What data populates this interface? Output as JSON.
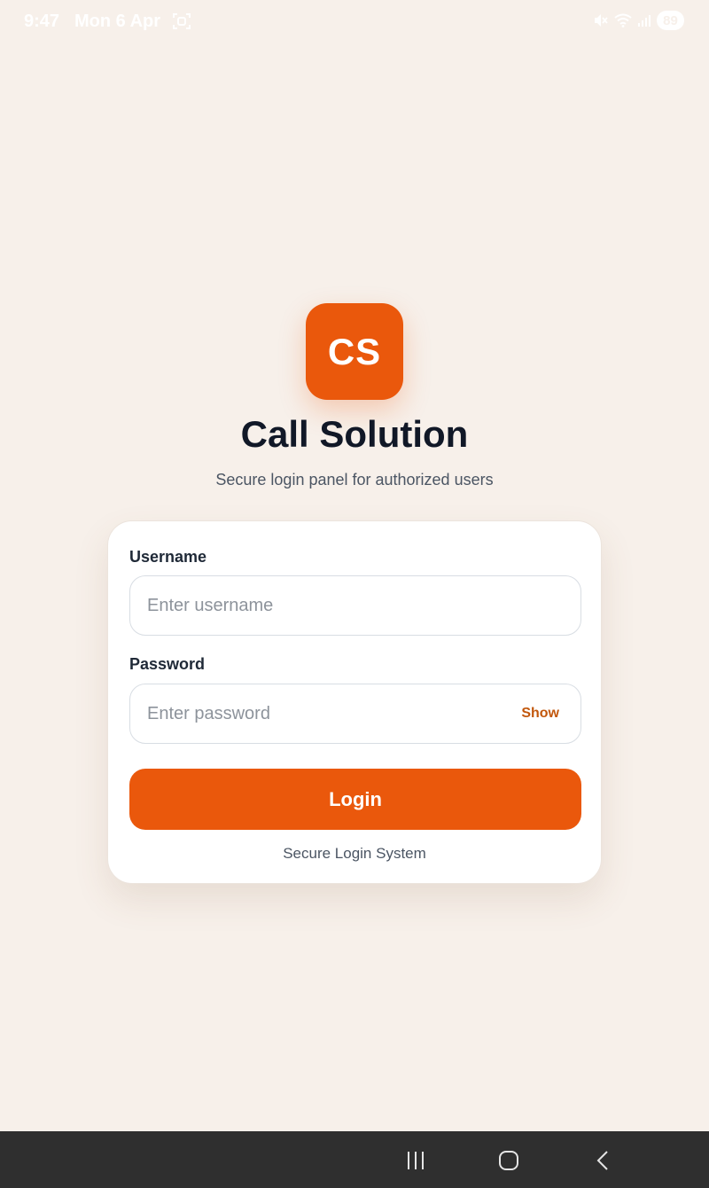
{
  "status_bar": {
    "time": "9:47",
    "date": "Mon 6 Apr",
    "battery": "89",
    "icons": [
      "screenshot-icon",
      "mute-icon",
      "wifi-icon",
      "signal-icon"
    ]
  },
  "app": {
    "logo_text": "CS",
    "title": "Call Solution",
    "subtitle": "Secure login panel for authorized users"
  },
  "login_form": {
    "username_label": "Username",
    "username_value": "",
    "username_placeholder": "Enter username",
    "password_label": "Password",
    "password_value": "",
    "password_placeholder": "Enter password",
    "show_label": "Show",
    "login_label": "Login",
    "footer_note": "Secure Login System"
  },
  "navigation_bar": {
    "buttons": [
      "recents-icon",
      "home-icon",
      "back-icon"
    ]
  },
  "colors": {
    "background": "#f7f0ea",
    "accent": "#ea580c",
    "title": "#111827",
    "nav_bar": "#2f2f2f"
  }
}
